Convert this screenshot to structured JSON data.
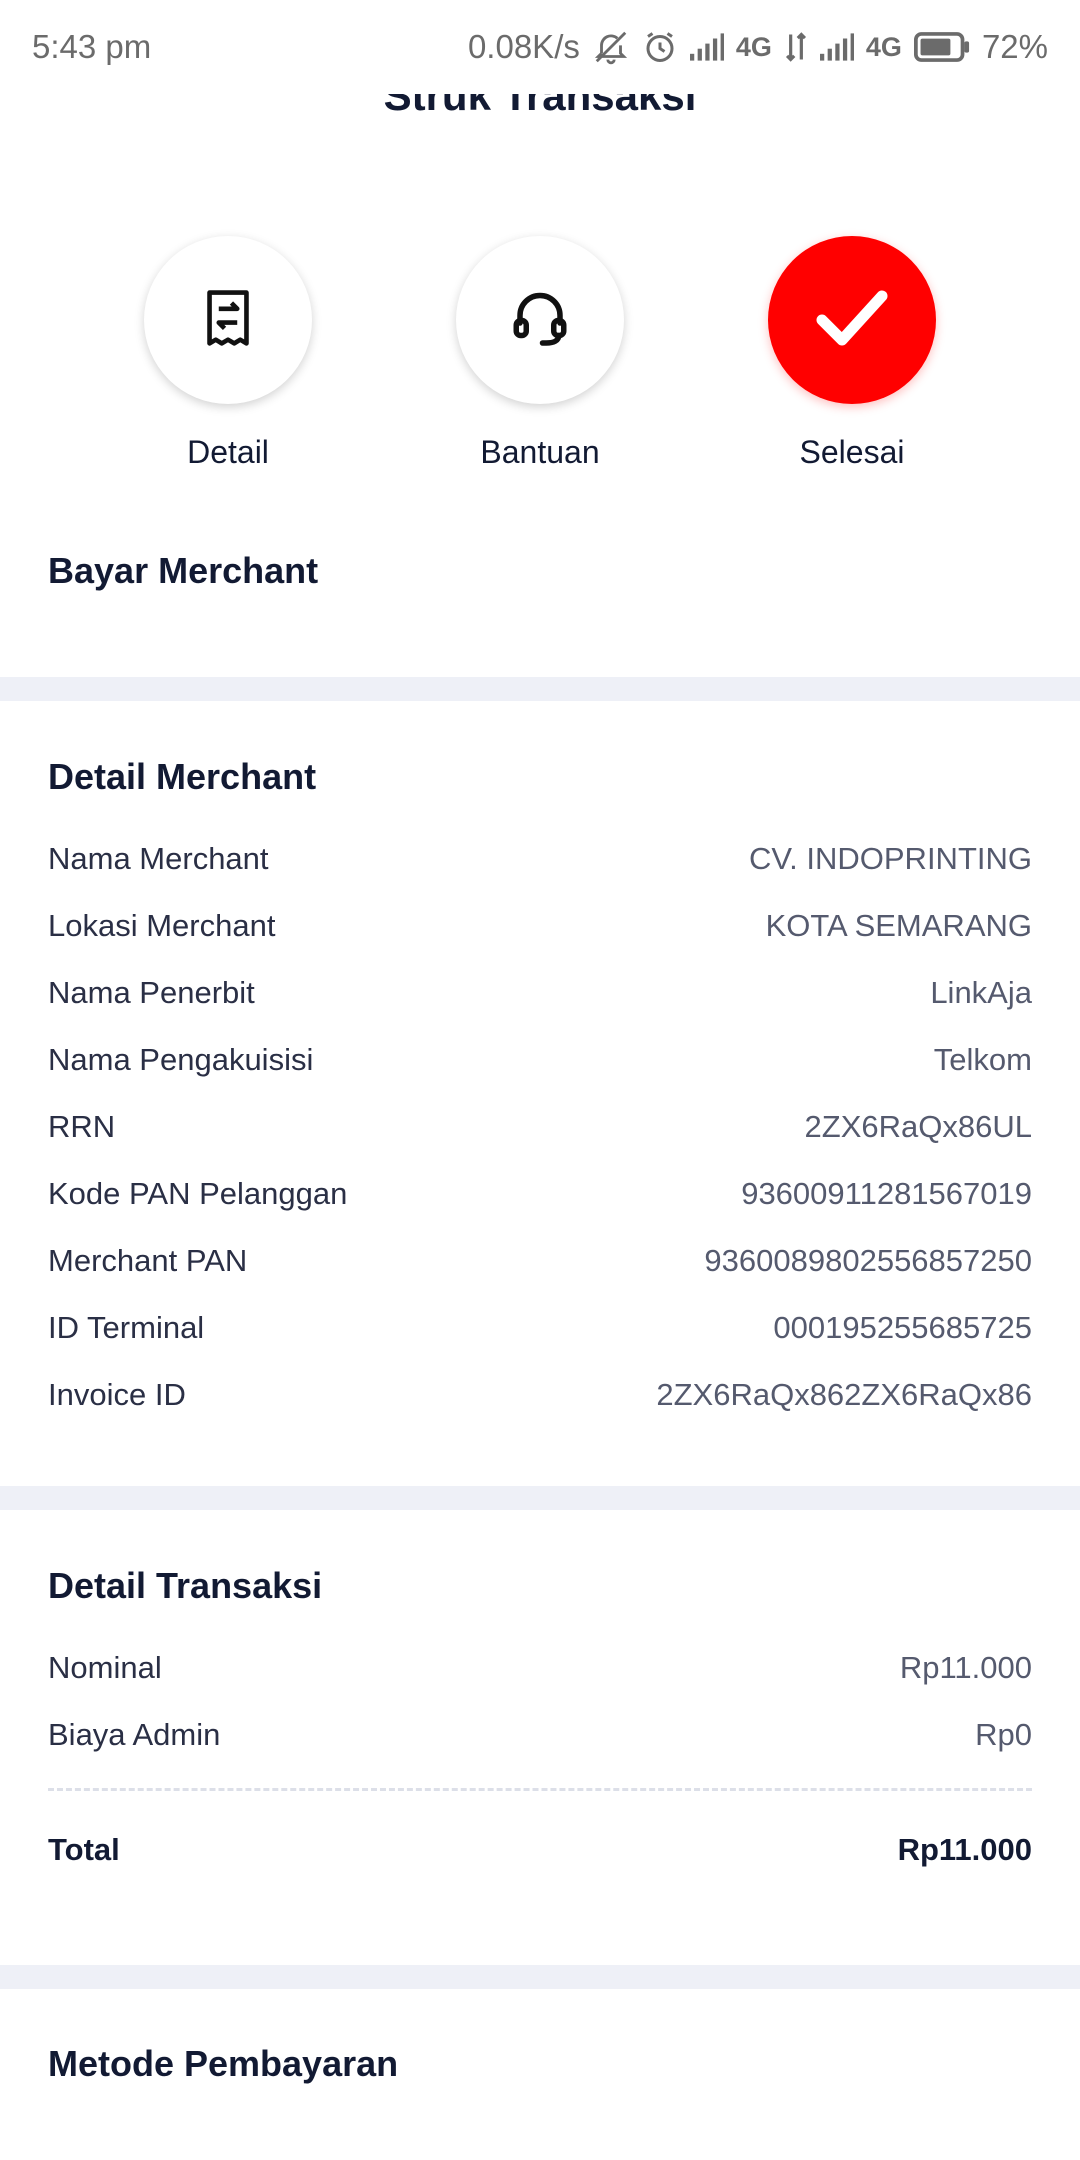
{
  "status_bar": {
    "time": "5:43 pm",
    "net_speed": "0.08K/s",
    "network1": "4G",
    "network2": "4G",
    "battery": "72%"
  },
  "header": {
    "title": "Struk Transaksi"
  },
  "actions": [
    {
      "label": "Detail",
      "icon": "receipt-icon"
    },
    {
      "label": "Bantuan",
      "icon": "headset-icon"
    },
    {
      "label": "Selesai",
      "icon": "check-icon"
    }
  ],
  "transaction_type": "Bayar Merchant",
  "merchant": {
    "title": "Detail Merchant",
    "rows": [
      {
        "k": "Nama Merchant",
        "v": "CV. INDOPRINTING"
      },
      {
        "k": "Lokasi Merchant",
        "v": "KOTA SEMARANG"
      },
      {
        "k": "Nama Penerbit",
        "v": "LinkAja"
      },
      {
        "k": "Nama Pengakuisisi",
        "v": "Telkom"
      },
      {
        "k": "RRN",
        "v": "2ZX6RaQx86UL"
      },
      {
        "k": "Kode PAN Pelanggan",
        "v": "93600911281567019"
      },
      {
        "k": "Merchant PAN",
        "v": "9360089802556857250"
      },
      {
        "k": "ID Terminal",
        "v": "000195255685725"
      },
      {
        "k": "Invoice ID",
        "v": "2ZX6RaQx862ZX6RaQx86"
      }
    ]
  },
  "transaction": {
    "title": "Detail Transaksi",
    "rows": [
      {
        "k": "Nominal",
        "v": "Rp11.000"
      },
      {
        "k": "Biaya Admin",
        "v": "Rp0"
      }
    ],
    "total": {
      "k": "Total",
      "v": "Rp11.000"
    }
  },
  "payment": {
    "title": "Metode Pembayaran"
  },
  "colors": {
    "accent": "#ff0000",
    "band": "#eef0f7",
    "text": "#121a33"
  }
}
